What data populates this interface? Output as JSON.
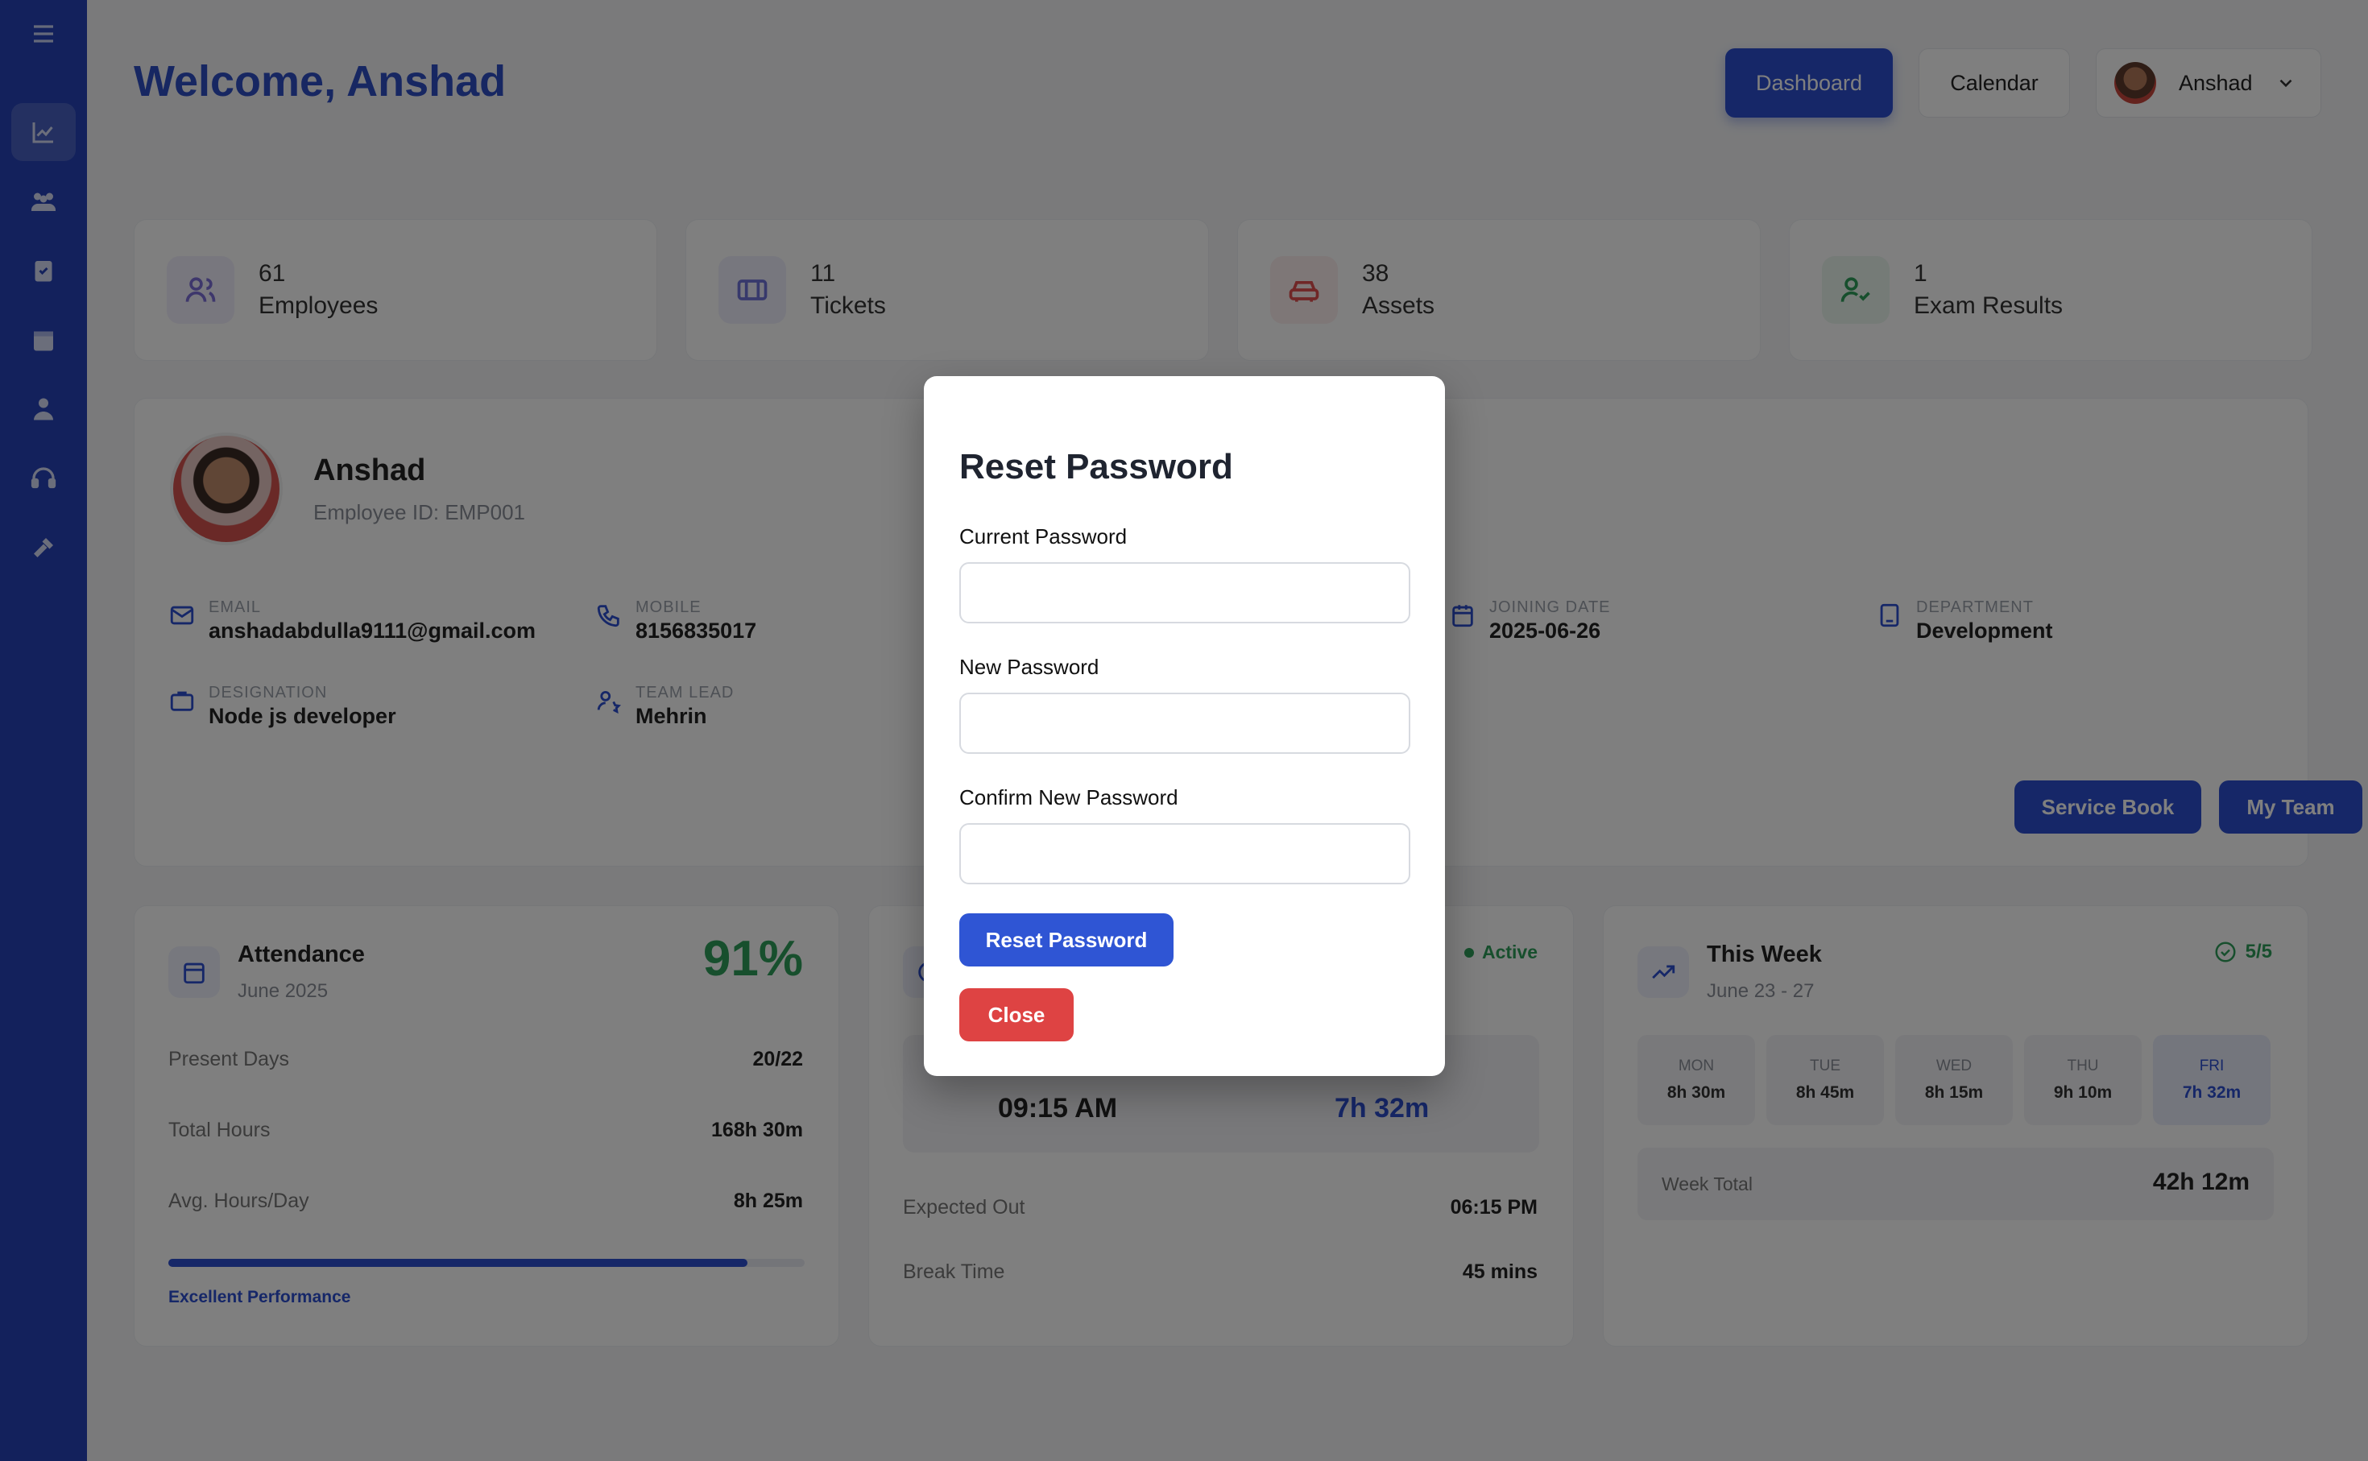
{
  "header": {
    "welcome": "Welcome, Anshad",
    "nav": {
      "dashboard": "Dashboard",
      "calendar": "Calendar",
      "user_name": "Anshad"
    }
  },
  "stats": [
    {
      "value": "61",
      "label": "Employees",
      "icon": "users-icon",
      "color": "#7c6fd8"
    },
    {
      "value": "11",
      "label": "Tickets",
      "icon": "ticket-icon",
      "color": "#6f72d8"
    },
    {
      "value": "38",
      "label": "Assets",
      "icon": "car-icon",
      "color": "#e04e4e"
    },
    {
      "value": "1",
      "label": "Exam Results",
      "icon": "user-check-icon",
      "color": "#2e9e5b"
    }
  ],
  "profile": {
    "name": "Anshad",
    "employee_id": "Employee ID: EMP001",
    "email_label": "EMAIL",
    "email": "anshadabdulla9111@gmail.com",
    "mobile_label": "MOBILE",
    "mobile": "8156835017",
    "joining_label": "JOINING DATE",
    "joining": "2025-06-26",
    "department_label": "DEPARTMENT",
    "department": "Development",
    "designation_label": "DESIGNATION",
    "designation": "Node js developer",
    "teamlead_label": "TEAM LEAD",
    "teamlead": "Mehrin",
    "service_book": "Service Book",
    "my_team": "My Team"
  },
  "attendance": {
    "title": "Attendance",
    "subtitle": "June 2025",
    "percent": "91%",
    "present_label": "Present Days",
    "present": "20/22",
    "total_label": "Total Hours",
    "total": "168h 30m",
    "avg_label": "Avg. Hours/Day",
    "avg": "8h 25m",
    "progress": 0.91,
    "footer": "Excellent Performance"
  },
  "today": {
    "status": "Active",
    "check_in": "09:15 AM",
    "worked": "7h 32m",
    "expected_label": "Expected Out",
    "expected": "06:15 PM",
    "break_label": "Break Time",
    "break": "45 mins"
  },
  "week": {
    "title": "This Week",
    "subtitle": "June 23 - 27",
    "badge": "5/5",
    "days": [
      {
        "day": "MON",
        "hours": "8h 30m"
      },
      {
        "day": "TUE",
        "hours": "8h 45m"
      },
      {
        "day": "WED",
        "hours": "8h 15m"
      },
      {
        "day": "THU",
        "hours": "9h 10m"
      },
      {
        "day": "FRI",
        "hours": "7h 32m"
      }
    ],
    "total_label": "Week Total",
    "total": "42h 12m"
  },
  "modal": {
    "title": "Reset Password",
    "current_label": "Current Password",
    "new_label": "New Password",
    "confirm_label": "Confirm New Password",
    "current_value": "",
    "new_value": "",
    "confirm_value": "",
    "submit": "Reset Password",
    "close": "Close"
  },
  "colors": {
    "brand": "#2d4fd0",
    "sidebar": "#2643b8",
    "danger": "#de4343",
    "success": "#2e9e5b"
  }
}
